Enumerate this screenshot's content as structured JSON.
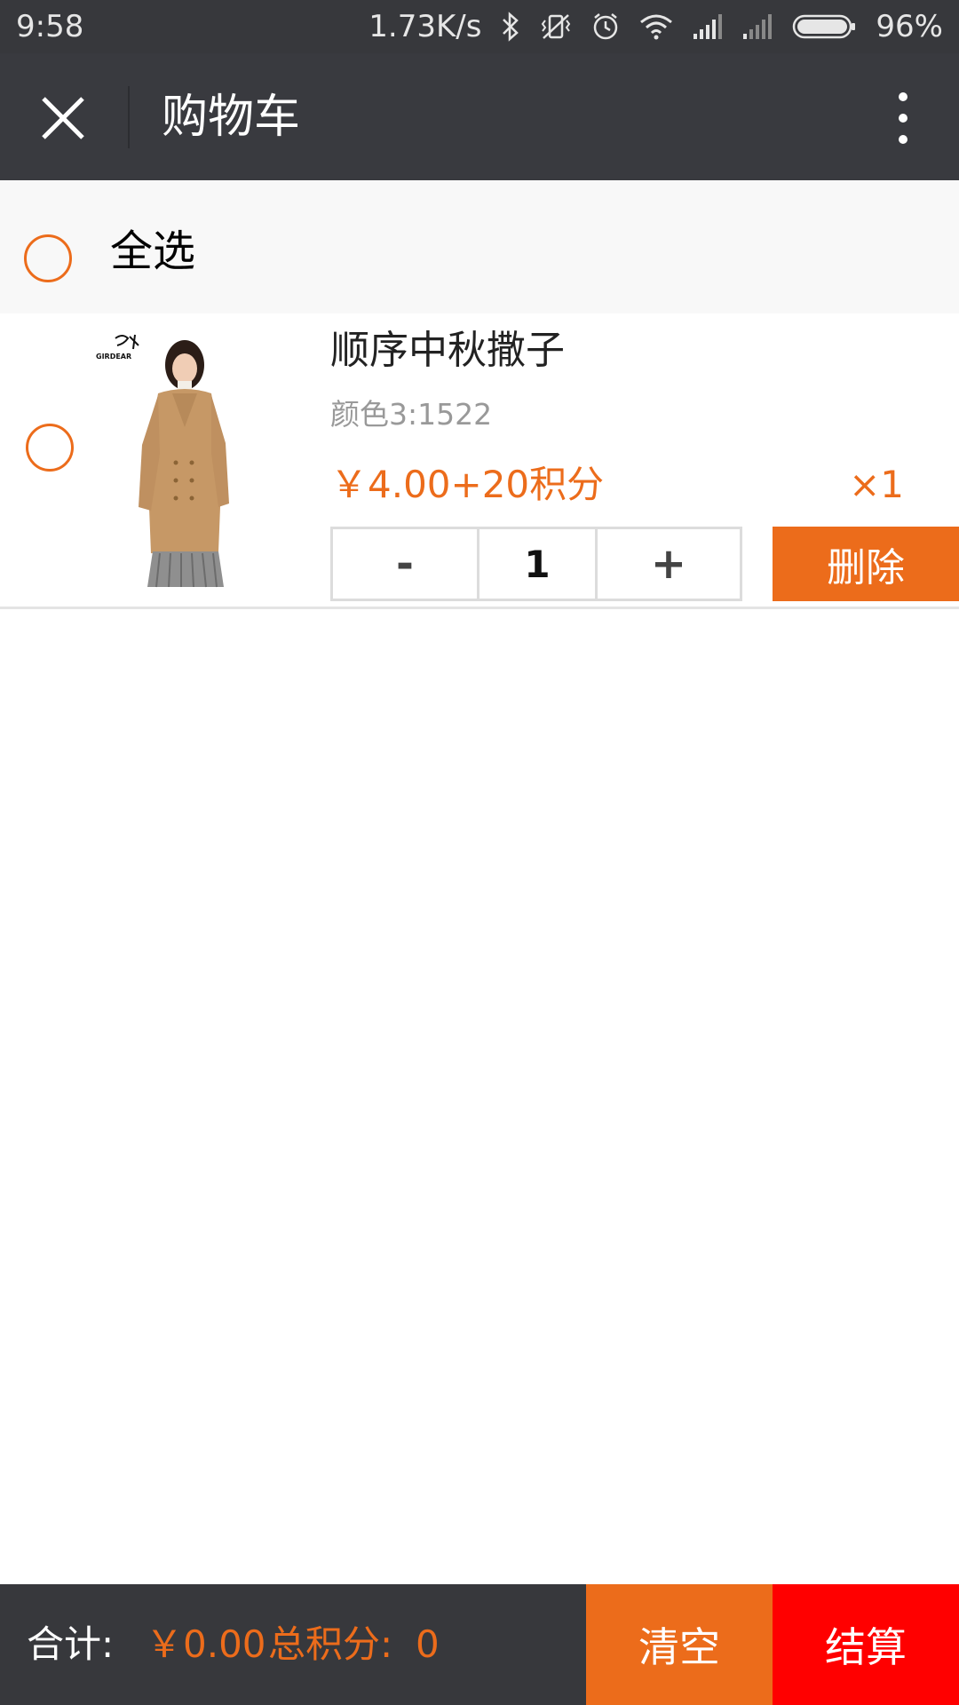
{
  "status_bar": {
    "time": "9:58",
    "network_speed": "1.73K/s",
    "battery": "96%",
    "icons": [
      "bluetooth-icon",
      "vibrate-icon",
      "alarm-icon",
      "wifi-icon",
      "signal-icon",
      "signal-weak-icon",
      "battery-icon"
    ]
  },
  "header": {
    "title": "购物车",
    "close_icon": "close-icon",
    "more_icon": "more-vertical-icon"
  },
  "select_all": {
    "label": "全选"
  },
  "cart_items": [
    {
      "name": "顺序中秋撒子",
      "spec": "颜色3:1522",
      "price": "￥4.00+20积分",
      "multiplier": "×1",
      "quantity": "1",
      "minus_label": "-",
      "plus_label": "+",
      "delete_label": "删除",
      "brand_logo": "GIRDEAR"
    }
  ],
  "footer": {
    "total_label": "合计:",
    "total_price": "￥0.00",
    "points_label": "总积分:",
    "points_value": "0",
    "clear_label": "清空",
    "checkout_label": "结算"
  },
  "colors": {
    "accent": "#ec6c1b",
    "checkout": "#ff0000",
    "header_bg": "#393a3f"
  }
}
